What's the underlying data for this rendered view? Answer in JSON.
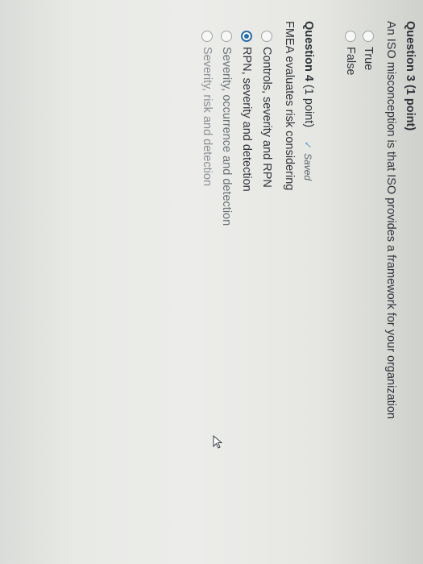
{
  "question3": {
    "label": "Question 3",
    "points": "(1 point)",
    "text": "An ISO misconception is that ISO provides a framework for your organization",
    "options": [
      "True",
      "False"
    ]
  },
  "question4": {
    "label": "Question 4",
    "points": "(1 point)",
    "saved_label": "Saved",
    "text": "FMEA evaluates risk considering",
    "options": [
      "Controls, severity and RPN",
      "RPN, severity and detection",
      "Severity, occurrence and detection",
      "Severity, risk and detection"
    ],
    "selected_index": 1
  },
  "colors": {
    "accent": "#2a6ca8",
    "saved_check": "#5b9bd5"
  },
  "icons": [
    "check-icon",
    "mouse-pointer-icon"
  ]
}
